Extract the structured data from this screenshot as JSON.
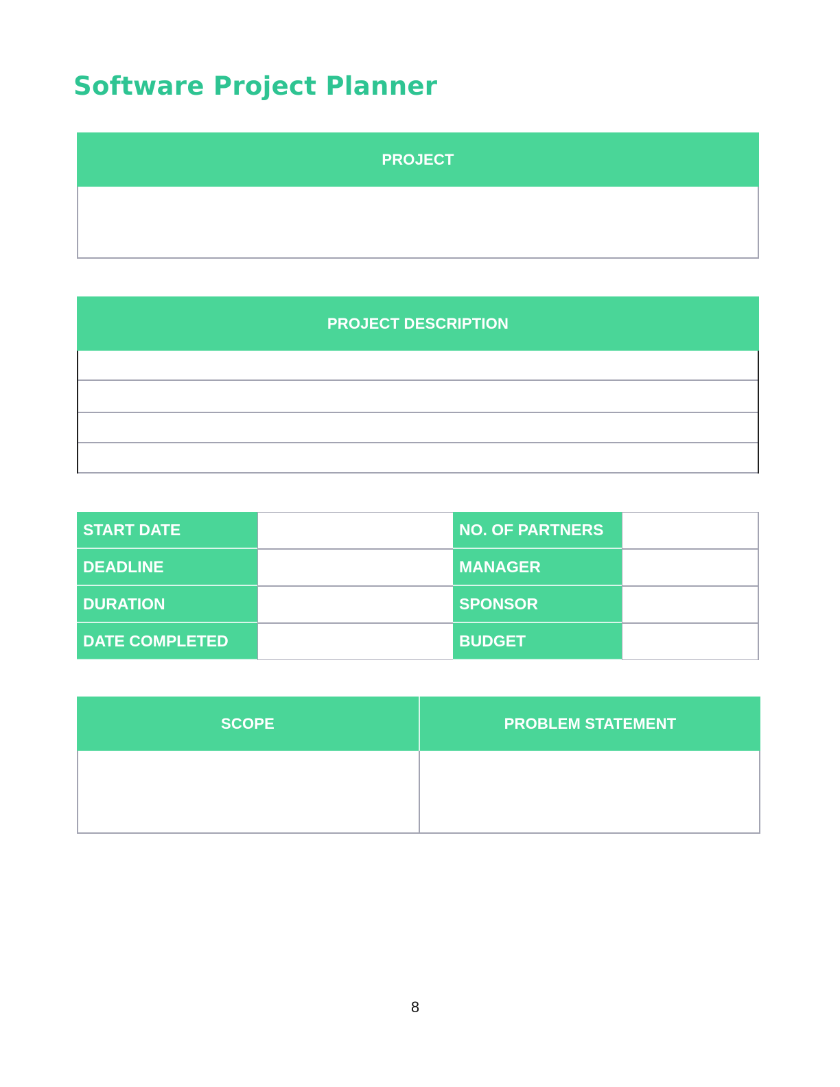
{
  "document": {
    "title": "Software Project Planner",
    "accent_color": "#4ad698",
    "title_color": "#2ec492",
    "page_number": "8"
  },
  "project_section": {
    "header": "PROJECT",
    "value": ""
  },
  "description_section": {
    "header": "PROJECT DESCRIPTION",
    "lines": [
      "",
      "",
      "",
      ""
    ]
  },
  "info_table": {
    "rows": [
      {
        "left_label": "START DATE",
        "left_value": "",
        "right_label": "NO. OF PARTNERS",
        "right_value": ""
      },
      {
        "left_label": "DEADLINE",
        "left_value": "",
        "right_label": "MANAGER",
        "right_value": ""
      },
      {
        "left_label": "DURATION",
        "left_value": "",
        "right_label": "SPONSOR",
        "right_value": ""
      },
      {
        "left_label": "DATE COMPLETED",
        "left_value": "",
        "right_label": "BUDGET",
        "right_value": ""
      }
    ]
  },
  "scope_section": {
    "scope_header": "SCOPE",
    "scope_value": "",
    "problem_header": "PROBLEM STATEMENT",
    "problem_value": ""
  }
}
